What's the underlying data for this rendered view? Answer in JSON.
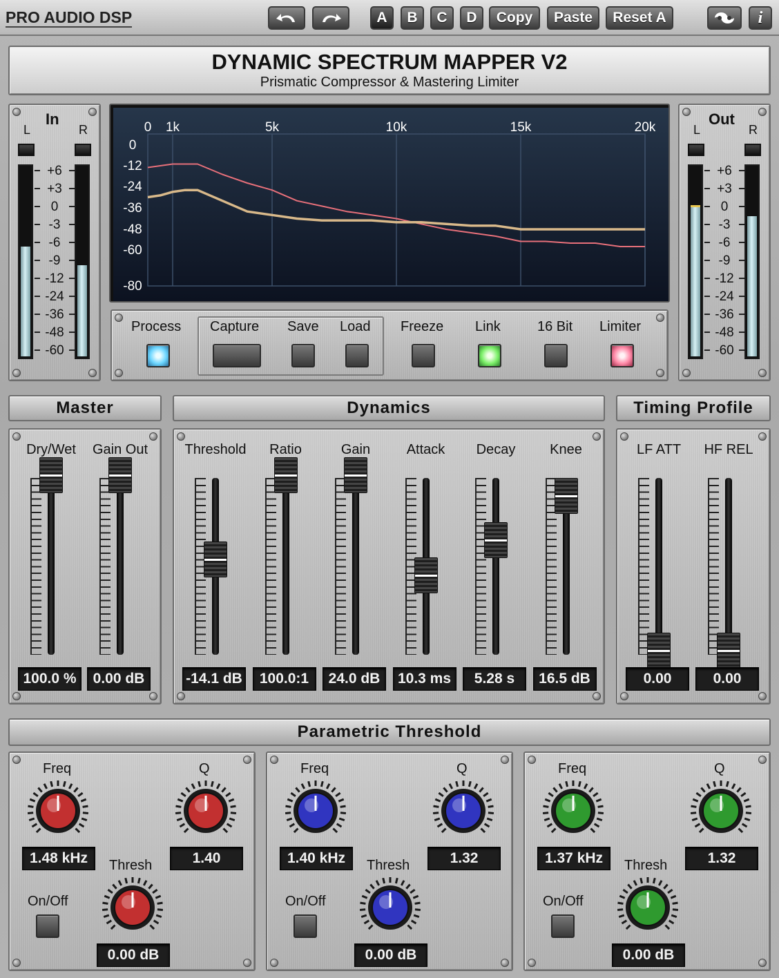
{
  "toolbar": {
    "brand": "PRO AUDIO DSP",
    "undo_icon": "undo-arrow-icon",
    "redo_icon": "redo-arrow-icon",
    "presets": [
      "A",
      "B",
      "C",
      "D"
    ],
    "selected_preset": "A",
    "copy_label": "Copy",
    "paste_label": "Paste",
    "reset_label": "Reset A",
    "logo_icon": "swirl-logo-icon",
    "info_icon": "info-icon",
    "info_glyph": "i"
  },
  "header": {
    "title": "DYNAMIC SPECTRUM MAPPER V2",
    "subtitle": "Prismatic Compressor & Mastering Limiter"
  },
  "meters": {
    "in": {
      "label": "In",
      "l": "L",
      "r": "R",
      "level_l": 0.58,
      "level_r": 0.48
    },
    "out": {
      "label": "Out",
      "l": "L",
      "r": "R",
      "level_l": 0.8,
      "level_r": 0.74
    },
    "scale": [
      "+6",
      "+3",
      "0",
      "-3",
      "-6",
      "-9",
      "-12",
      "-24",
      "-36",
      "-48",
      "-60"
    ]
  },
  "chart_data": {
    "type": "line",
    "x_ticks": [
      "0",
      "1k",
      "5k",
      "10k",
      "15k",
      "20k"
    ],
    "y_ticks": [
      "0",
      "-12",
      "-24",
      "-36",
      "-48",
      "-60",
      "-80"
    ],
    "xlim": [
      0,
      20000
    ],
    "grid": true,
    "series": [
      {
        "color": "#e8707a",
        "x": [
          0,
          500,
          1000,
          1500,
          2000,
          3000,
          4000,
          5000,
          6000,
          7000,
          8000,
          9000,
          10000,
          11000,
          12000,
          13000,
          14000,
          15000,
          16000,
          17000,
          18000,
          19000,
          20000
        ],
        "y": [
          -13,
          -12,
          -11,
          -11,
          -11,
          -17,
          -22,
          -26,
          -32,
          -35,
          -38,
          -40,
          -42,
          -45,
          -48,
          -50,
          -52,
          -55,
          -55,
          -56,
          -56,
          -58,
          -58
        ]
      },
      {
        "color": "#d9b98a",
        "x": [
          0,
          500,
          1000,
          1500,
          2000,
          3000,
          4000,
          5000,
          6000,
          7000,
          8000,
          9000,
          10000,
          11000,
          12000,
          13000,
          14000,
          15000,
          16000,
          17000,
          18000,
          19000,
          20000
        ],
        "y": [
          -30,
          -29,
          -27,
          -26,
          -26,
          -32,
          -38,
          -40,
          -42,
          -43,
          -43,
          -43,
          -44,
          -44,
          -45,
          -46,
          -46,
          -48,
          -48,
          -48,
          -48,
          -48,
          -48
        ]
      }
    ]
  },
  "controls": {
    "process": "Process",
    "capture": "Capture",
    "save": "Save",
    "load": "Load",
    "freeze": "Freeze",
    "link": "Link",
    "bit16": "16 Bit",
    "limiter": "Limiter",
    "process_state": "on",
    "link_state": "on",
    "limiter_state": "on"
  },
  "master": {
    "title": "Master",
    "faders": [
      {
        "label": "Dry/Wet",
        "value": "100.0 %",
        "level": 1.0
      },
      {
        "label": "Gain Out",
        "value": "0.00 dB",
        "level": 1.0
      }
    ]
  },
  "dynamics": {
    "title": "Dynamics",
    "faders": [
      {
        "label": "Threshold",
        "value": "-14.1 dB",
        "level": 0.52
      },
      {
        "label": "Ratio",
        "value": "100.0:1",
        "level": 1.0
      },
      {
        "label": "Gain",
        "value": "24.0 dB",
        "level": 1.0
      },
      {
        "label": "Attack",
        "value": "10.3 ms",
        "level": 0.43
      },
      {
        "label": "Decay",
        "value": "5.28 s",
        "level": 0.63
      },
      {
        "label": "Knee",
        "value": "16.5 dB",
        "level": 0.88
      }
    ]
  },
  "timing": {
    "title": "Timing Profile",
    "faders": [
      {
        "label": "LF ATT",
        "value": "0.00",
        "level": 0.0
      },
      {
        "label": "HF REL",
        "value": "0.00",
        "level": 0.0
      }
    ]
  },
  "parametric": {
    "title": "Parametric Threshold",
    "bands": [
      {
        "freq_label": "Freq",
        "q_label": "Q",
        "thresh_label": "Thresh",
        "onoff_label": "On/Off",
        "freq": "1.48 kHz",
        "q": "1.40",
        "thresh": "0.00 dB",
        "color": "#c23030"
      },
      {
        "freq_label": "Freq",
        "q_label": "Q",
        "thresh_label": "Thresh",
        "onoff_label": "On/Off",
        "freq": "1.40 kHz",
        "q": "1.32",
        "thresh": "0.00 dB",
        "color": "#3035c0"
      },
      {
        "freq_label": "Freq",
        "q_label": "Q",
        "thresh_label": "Thresh",
        "onoff_label": "On/Off",
        "freq": "1.37 kHz",
        "q": "1.32",
        "thresh": "0.00 dB",
        "color": "#2f9a2f"
      }
    ]
  }
}
